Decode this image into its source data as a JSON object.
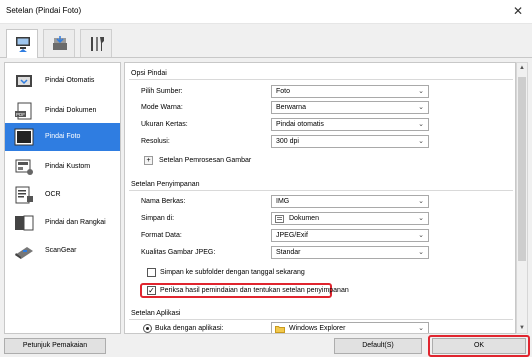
{
  "window": {
    "title": "Setelan (Pindai Foto)",
    "close_glyph": "✕"
  },
  "tabs": [
    {
      "icon": "scanner-computer-icon",
      "active": true
    },
    {
      "icon": "scanner-icon",
      "active": false
    },
    {
      "icon": "tools-icon",
      "active": false
    }
  ],
  "sidebar": {
    "items": [
      {
        "label": "Pindai Otomatis",
        "icon": "auto-scan-icon",
        "active": false
      },
      {
        "label": "Pindai Dokumen",
        "icon": "pdf-document-icon",
        "active": false
      },
      {
        "label": "Pindai Foto",
        "icon": "photo-icon",
        "active": true
      },
      {
        "label": "Pindai Kustom",
        "icon": "custom-scan-icon",
        "active": false
      },
      {
        "label": "OCR",
        "icon": "ocr-icon",
        "active": false
      },
      {
        "label": "Pindai dan Rangkai",
        "icon": "stitch-icon",
        "active": false
      },
      {
        "label": "ScanGear",
        "icon": "scangear-icon",
        "active": false
      }
    ]
  },
  "scan_options": {
    "title": "Opsi Pindai",
    "source_label": "Pilih Sumber:",
    "source_value": "Foto",
    "color_label": "Mode Warna:",
    "color_value": "Berwarna",
    "paper_label": "Ukuran Kertas:",
    "paper_value": "Pindai otomatis",
    "resolution_label": "Resolusi:",
    "resolution_value": "300 dpi",
    "image_processing_label": "Setelan Pemrosesan Gambar",
    "expand_glyph": "+"
  },
  "save_settings": {
    "title": "Setelan Penyimpanan",
    "filename_label": "Nama Berkas:",
    "filename_value": "IMG",
    "save_in_label": "Simpan di:",
    "save_in_value": "Dokumen",
    "format_label": "Format Data:",
    "format_value": "JPEG/Exif",
    "quality_label": "Kualitas Gambar JPEG:",
    "quality_value": "Standar",
    "subfolder_label": "Simpan ke subfolder dengan tanggal sekarang",
    "subfolder_checked": false,
    "check_results_label": "Periksa hasil pemindaian dan tentukan setelan penyimpanan",
    "check_results_checked": true,
    "check_glyph": "✓"
  },
  "app_settings": {
    "title": "Setelan Aplikasi",
    "open_with_label": "Buka dengan aplikasi:",
    "open_with_value": "Windows Explorer"
  },
  "footer": {
    "instructions_label": "Petunjuk Pemakaian",
    "defaults_label": "Default(S)",
    "ok_label": "OK"
  },
  "dropdown_glyph": "⌄",
  "colors": {
    "accent": "#2f7de1",
    "highlight": "#e0252f"
  }
}
